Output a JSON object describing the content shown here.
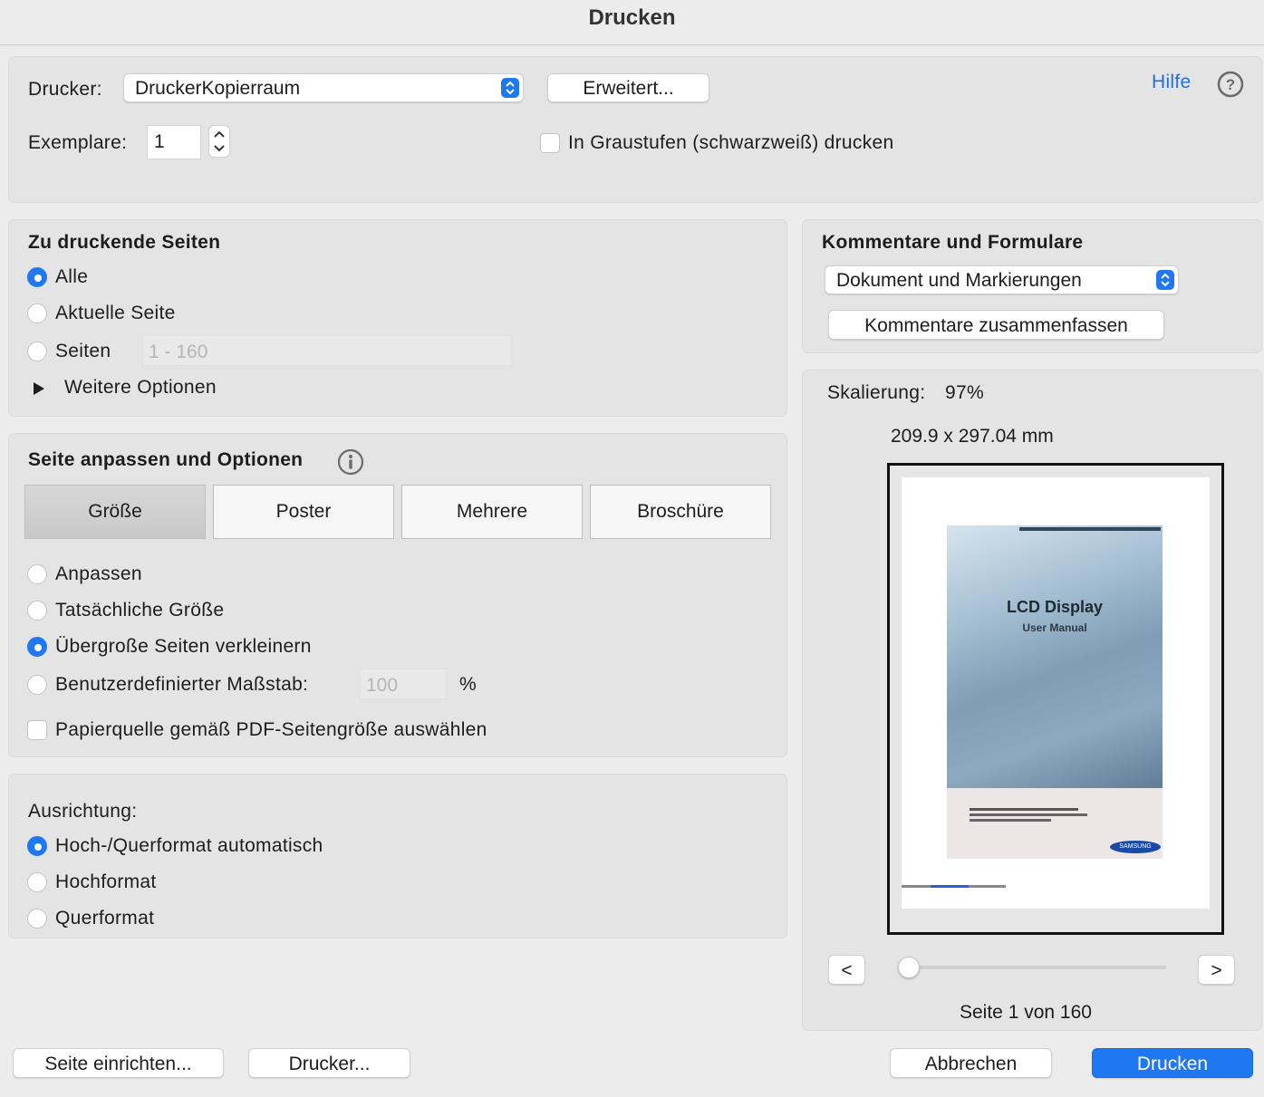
{
  "window": {
    "title": "Drucken"
  },
  "printer": {
    "label": "Drucker:",
    "selected": "DruckerKopierraum",
    "advanced_button": "Erweitert...",
    "help_link": "Hilfe",
    "copies_label": "Exemplare:",
    "copies_value": "1",
    "grayscale_label": "In Graustufen (schwarzweiß) drucken",
    "grayscale_checked": false
  },
  "pages": {
    "heading": "Zu druckende Seiten",
    "options": [
      {
        "label": "Alle",
        "selected": true
      },
      {
        "label": "Aktuelle Seite",
        "selected": false
      },
      {
        "label": "Seiten",
        "selected": false
      }
    ],
    "range_placeholder": "1 - 160",
    "more_options": "Weitere Optionen"
  },
  "sizing": {
    "heading": "Seite anpassen und Optionen",
    "tabs": [
      "Größe",
      "Poster",
      "Mehrere",
      "Broschüre"
    ],
    "active_tab": "Größe",
    "options": [
      {
        "label": "Anpassen",
        "selected": false
      },
      {
        "label": "Tatsächliche Größe",
        "selected": false
      },
      {
        "label": "Übergroße Seiten verkleinern",
        "selected": true
      },
      {
        "label": "Benutzerdefinierter Maßstab:",
        "selected": false
      }
    ],
    "scale_value": "100",
    "scale_unit": "%",
    "paper_source_label": "Papierquelle gemäß PDF-Seitengröße auswählen",
    "paper_source_checked": false
  },
  "orientation": {
    "heading": "Ausrichtung:",
    "options": [
      {
        "label": "Hoch-/Querformat automatisch",
        "selected": true
      },
      {
        "label": "Hochformat",
        "selected": false
      },
      {
        "label": "Querformat",
        "selected": false
      }
    ]
  },
  "comments": {
    "heading": "Kommentare und Formulare",
    "selected": "Dokument und Markierungen",
    "summarize_button": "Kommentare zusammenfassen"
  },
  "preview": {
    "scaling_label": "Skalierung:",
    "scaling_value": "97%",
    "dimensions": "209.9 x 297.04 mm",
    "doc_title": "LCD Display",
    "doc_subtitle": "User Manual",
    "doc_brand": "SAMSUNG",
    "prev_button": "<",
    "next_button": ">",
    "page_status": "Seite 1 von 160",
    "current_page": 1,
    "total_pages": 160
  },
  "footer": {
    "page_setup_button": "Seite einrichten...",
    "printer_button": "Drucker...",
    "cancel_button": "Abbrechen",
    "print_button": "Drucken"
  },
  "colors": {
    "accent": "#1f78f2",
    "panel": "#e4e4e4",
    "background": "#ececec"
  }
}
